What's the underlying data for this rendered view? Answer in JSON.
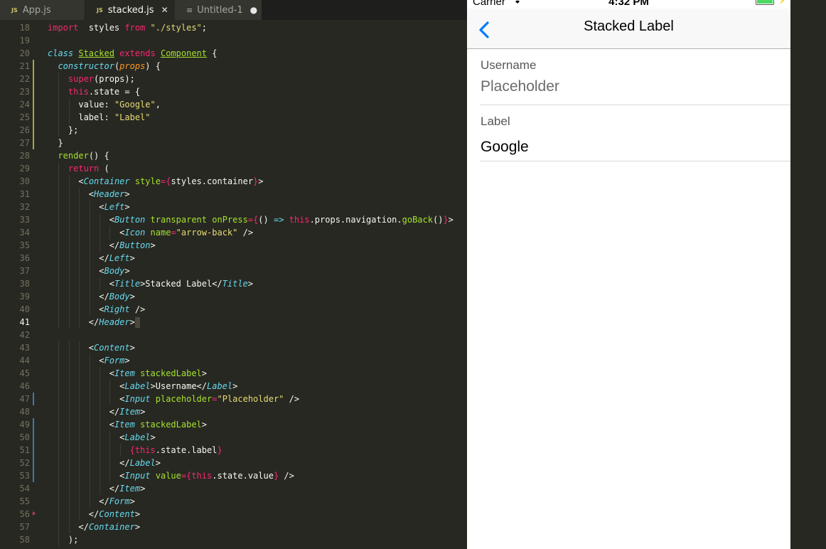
{
  "editor": {
    "tabs": [
      {
        "badge": "JS",
        "label": "App.js",
        "control": ""
      },
      {
        "badge": "JS",
        "label": "stacked.js",
        "control": "✕"
      },
      {
        "badge": "≡",
        "label": "Untitled-1",
        "control": "●"
      }
    ],
    "active_tab": 1,
    "current_line": "41",
    "lines": [
      {
        "n": "18",
        "ind": 0,
        "g": "",
        "t": [
          [
            "kw",
            "import"
          ],
          [
            "",
            "  styles "
          ],
          [
            "kw",
            "from"
          ],
          [
            "st",
            " \"./styles\""
          ],
          [
            "",
            ";"
          ]
        ]
      },
      {
        "n": "19",
        "ind": 0,
        "g": "",
        "t": []
      },
      {
        "n": "20",
        "ind": 0,
        "g": "",
        "t": [
          [
            "it",
            "class"
          ],
          [
            "",
            " "
          ],
          [
            "cls",
            "Stacked"
          ],
          [
            "",
            " "
          ],
          [
            "kw",
            "extends"
          ],
          [
            "",
            " "
          ],
          [
            "cls",
            "Component"
          ],
          [
            "",
            " {"
          ]
        ]
      },
      {
        "n": "21",
        "ind": 1,
        "g": "mod",
        "t": [
          [
            "it",
            "constructor"
          ],
          [
            "",
            "("
          ],
          [
            "par",
            "props"
          ],
          [
            "",
            ") {"
          ]
        ]
      },
      {
        "n": "22",
        "ind": 2,
        "g": "mod",
        "t": [
          [
            "kw",
            "super"
          ],
          [
            "",
            "(props);"
          ]
        ]
      },
      {
        "n": "23",
        "ind": 2,
        "g": "mod",
        "t": [
          [
            "kw",
            "this"
          ],
          [
            "",
            ".state = {"
          ]
        ]
      },
      {
        "n": "24",
        "ind": 3,
        "g": "mod",
        "t": [
          [
            "",
            "value: "
          ],
          [
            "st",
            "\"Google\""
          ],
          [
            "",
            ","
          ]
        ]
      },
      {
        "n": "25",
        "ind": 3,
        "g": "mod",
        "t": [
          [
            "",
            "label: "
          ],
          [
            "st",
            "\"Label\""
          ]
        ]
      },
      {
        "n": "26",
        "ind": 2,
        "g": "mod",
        "t": [
          [
            "",
            "};"
          ]
        ]
      },
      {
        "n": "27",
        "ind": 1,
        "g": "mod",
        "t": [
          [
            "",
            "}"
          ]
        ]
      },
      {
        "n": "28",
        "ind": 1,
        "g": "",
        "t": [
          [
            "ent",
            "render"
          ],
          [
            "",
            "() {"
          ]
        ]
      },
      {
        "n": "29",
        "ind": 2,
        "g": "",
        "t": [
          [
            "kw",
            "return"
          ],
          [
            "",
            " ("
          ]
        ]
      },
      {
        "n": "30",
        "ind": 3,
        "g": "",
        "t": [
          [
            "",
            "<"
          ],
          [
            "tg",
            "Container"
          ],
          [
            "",
            " "
          ],
          [
            "ent",
            "style"
          ],
          [
            "kw",
            "="
          ],
          [
            "kw",
            "{"
          ],
          [
            "",
            "styles.container"
          ],
          [
            "kw",
            "}"
          ],
          [
            "",
            ">"
          ]
        ]
      },
      {
        "n": "31",
        "ind": 4,
        "g": "",
        "t": [
          [
            "",
            "<"
          ],
          [
            "tg",
            "Header"
          ],
          [
            "",
            ">"
          ]
        ]
      },
      {
        "n": "32",
        "ind": 5,
        "g": "",
        "t": [
          [
            "",
            "<"
          ],
          [
            "tg",
            "Left"
          ],
          [
            "",
            ">"
          ]
        ]
      },
      {
        "n": "33",
        "ind": 6,
        "g": "",
        "t": [
          [
            "",
            "<"
          ],
          [
            "tg",
            "Button"
          ],
          [
            "",
            " "
          ],
          [
            "ent",
            "transparent"
          ],
          [
            "",
            " "
          ],
          [
            "ent",
            "onPress"
          ],
          [
            "kw",
            "="
          ],
          [
            "kw",
            "{"
          ],
          [
            "",
            "() "
          ],
          [
            "it",
            "=>"
          ],
          [
            "",
            " "
          ],
          [
            "kw",
            "this"
          ],
          [
            "",
            ".props.navigation."
          ],
          [
            "ent",
            "goBack"
          ],
          [
            "",
            "()"
          ],
          [
            "kw",
            "}"
          ],
          [
            "",
            ">"
          ]
        ]
      },
      {
        "n": "34",
        "ind": 7,
        "g": "",
        "t": [
          [
            "",
            "<"
          ],
          [
            "tg",
            "Icon"
          ],
          [
            "",
            " "
          ],
          [
            "ent",
            "name"
          ],
          [
            "kw",
            "="
          ],
          [
            "st",
            "\"arrow-back\""
          ],
          [
            "",
            " />"
          ]
        ]
      },
      {
        "n": "35",
        "ind": 6,
        "g": "",
        "t": [
          [
            "",
            "</"
          ],
          [
            "tg",
            "Button"
          ],
          [
            "",
            ">"
          ]
        ]
      },
      {
        "n": "36",
        "ind": 5,
        "g": "",
        "t": [
          [
            "",
            "</"
          ],
          [
            "tg",
            "Left"
          ],
          [
            "",
            ">"
          ]
        ]
      },
      {
        "n": "37",
        "ind": 5,
        "g": "",
        "t": [
          [
            "",
            "<"
          ],
          [
            "tg",
            "Body"
          ],
          [
            "",
            ">"
          ]
        ]
      },
      {
        "n": "38",
        "ind": 6,
        "g": "",
        "t": [
          [
            "",
            "<"
          ],
          [
            "tg",
            "Title"
          ],
          [
            "",
            ">Stacked Label</"
          ],
          [
            "tg",
            "Title"
          ],
          [
            "",
            ">"
          ]
        ]
      },
      {
        "n": "39",
        "ind": 5,
        "g": "",
        "t": [
          [
            "",
            "</"
          ],
          [
            "tg",
            "Body"
          ],
          [
            "",
            ">"
          ]
        ]
      },
      {
        "n": "40",
        "ind": 5,
        "g": "",
        "t": [
          [
            "",
            "<"
          ],
          [
            "tg",
            "Right"
          ],
          [
            "",
            " />"
          ]
        ]
      },
      {
        "n": "41",
        "ind": 4,
        "g": "",
        "caret": true,
        "t": [
          [
            "",
            "</"
          ],
          [
            "tg",
            "Header"
          ],
          [
            "",
            ">"
          ]
        ]
      },
      {
        "n": "42",
        "ind": 0,
        "g": "",
        "t": []
      },
      {
        "n": "43",
        "ind": 4,
        "g": "",
        "t": [
          [
            "",
            "<"
          ],
          [
            "tg",
            "Content"
          ],
          [
            "",
            ">"
          ]
        ]
      },
      {
        "n": "44",
        "ind": 5,
        "g": "",
        "t": [
          [
            "",
            "<"
          ],
          [
            "tg",
            "Form"
          ],
          [
            "",
            ">"
          ]
        ]
      },
      {
        "n": "45",
        "ind": 6,
        "g": "",
        "t": [
          [
            "",
            "<"
          ],
          [
            "tg",
            "Item"
          ],
          [
            "",
            " "
          ],
          [
            "ent",
            "stackedLabel"
          ],
          [
            "",
            ">"
          ]
        ]
      },
      {
        "n": "46",
        "ind": 7,
        "g": "",
        "t": [
          [
            "",
            "<"
          ],
          [
            "tg",
            "Label"
          ],
          [
            "",
            ">Username</"
          ],
          [
            "tg",
            "Label"
          ],
          [
            "",
            ">"
          ]
        ]
      },
      {
        "n": "47",
        "ind": 7,
        "g": "add",
        "t": [
          [
            "",
            "<"
          ],
          [
            "tg",
            "Input"
          ],
          [
            "",
            " "
          ],
          [
            "ent",
            "placeholder"
          ],
          [
            "kw",
            "="
          ],
          [
            "st",
            "\"Placeholder\""
          ],
          [
            "",
            " />"
          ]
        ]
      },
      {
        "n": "48",
        "ind": 6,
        "g": "",
        "t": [
          [
            "",
            "</"
          ],
          [
            "tg",
            "Item"
          ],
          [
            "",
            ">"
          ]
        ]
      },
      {
        "n": "49",
        "ind": 6,
        "g": "add",
        "t": [
          [
            "",
            "<"
          ],
          [
            "tg",
            "Item"
          ],
          [
            "",
            " "
          ],
          [
            "ent",
            "stackedLabel"
          ],
          [
            "",
            ">"
          ]
        ]
      },
      {
        "n": "50",
        "ind": 7,
        "g": "add",
        "t": [
          [
            "",
            "<"
          ],
          [
            "tg",
            "Label"
          ],
          [
            "",
            ">"
          ]
        ]
      },
      {
        "n": "51",
        "ind": 8,
        "g": "add",
        "t": [
          [
            "kw",
            "{"
          ],
          [
            "kw",
            "this"
          ],
          [
            "",
            ".state.label"
          ],
          [
            "kw",
            "}"
          ]
        ]
      },
      {
        "n": "52",
        "ind": 7,
        "g": "add",
        "t": [
          [
            "",
            "</"
          ],
          [
            "tg",
            "Label"
          ],
          [
            "",
            ">"
          ]
        ]
      },
      {
        "n": "53",
        "ind": 7,
        "g": "add",
        "t": [
          [
            "",
            "<"
          ],
          [
            "tg",
            "Input"
          ],
          [
            "",
            " "
          ],
          [
            "ent",
            "value"
          ],
          [
            "kw",
            "="
          ],
          [
            "kw",
            "{"
          ],
          [
            "kw",
            "this"
          ],
          [
            "",
            ".state.value"
          ],
          [
            "kw",
            "}"
          ],
          [
            "",
            " />"
          ]
        ]
      },
      {
        "n": "54",
        "ind": 6,
        "g": "",
        "t": [
          [
            "",
            "</"
          ],
          [
            "tg",
            "Item"
          ],
          [
            "",
            ">"
          ]
        ]
      },
      {
        "n": "55",
        "ind": 5,
        "g": "",
        "t": [
          [
            "",
            "</"
          ],
          [
            "tg",
            "Form"
          ],
          [
            "",
            ">"
          ]
        ]
      },
      {
        "n": "56",
        "ind": 4,
        "g": "fold",
        "t": [
          [
            "",
            "</"
          ],
          [
            "tg",
            "Content"
          ],
          [
            "",
            ">"
          ]
        ]
      },
      {
        "n": "57",
        "ind": 3,
        "g": "",
        "t": [
          [
            "",
            "</"
          ],
          [
            "tg",
            "Container"
          ],
          [
            "",
            ">"
          ]
        ]
      },
      {
        "n": "58",
        "ind": 2,
        "g": "",
        "t": [
          [
            "",
            ");"
          ]
        ]
      }
    ]
  },
  "simulator": {
    "status": {
      "carrier": "Carrier",
      "time": "4:32 PM",
      "wifi_icon": "wifi-icon",
      "battery_level": 1.0,
      "battery_color": "#4cd964"
    },
    "navbar": {
      "back_icon": "chevron-left-icon",
      "title": "Stacked Label",
      "accent": "#007aff"
    },
    "form": {
      "username_label": "Username",
      "username_placeholder": "Placeholder",
      "label_label": "Label",
      "label_value": "Google"
    }
  }
}
